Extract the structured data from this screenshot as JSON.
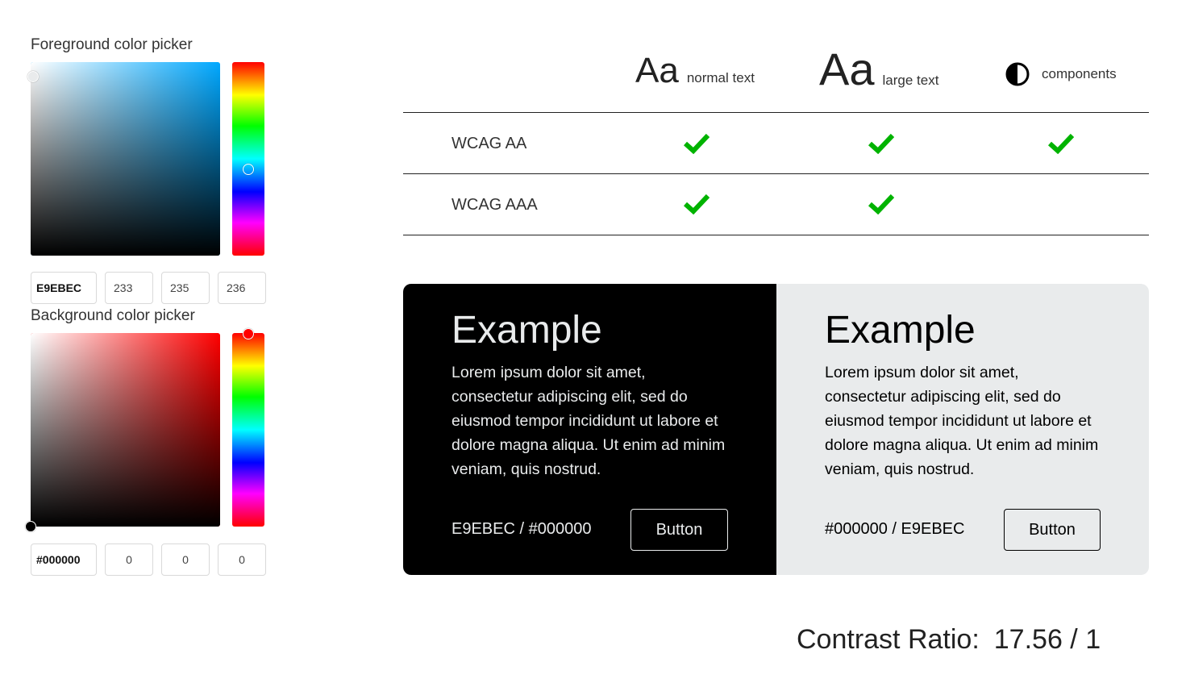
{
  "foreground": {
    "label": "Foreground color picker",
    "hue_color": "#00a8ff",
    "hex": "E9EBEC",
    "r": "233",
    "g": "235",
    "b": "236"
  },
  "background": {
    "label": "Background color picker",
    "hue_color": "#ff0000",
    "hex": "#000000",
    "r": "0",
    "g": "0",
    "b": "0"
  },
  "table": {
    "headers": [
      {
        "glyph": "Aa",
        "label": "normal text"
      },
      {
        "glyph": "Aa",
        "label": "large text"
      },
      {
        "icon": "contrast-icon",
        "label": "components"
      }
    ],
    "rows": [
      {
        "label": "WCAG AA",
        "normal": true,
        "large": true,
        "components": true
      },
      {
        "label": "WCAG AAA",
        "normal": true,
        "large": true,
        "components": false
      }
    ],
    "check_color": "#00b300"
  },
  "preview": {
    "dark": {
      "title": "Example",
      "body": "Lorem ipsum dolor sit amet, consectetur adipiscing elit, sed do eiusmod tempor incididunt ut labore et dolore magna aliqua. Ut enim ad minim veniam, quis nostrud.",
      "pair": "E9EBEC / #000000",
      "button": "Button",
      "bg": "#000000",
      "fg": "#E9EBEC"
    },
    "light": {
      "title": "Example",
      "body": "Lorem ipsum dolor sit amet, consectetur adipiscing elit, sed do eiusmod tempor incididunt ut labore et dolore magna aliqua. Ut enim ad minim veniam, quis nostrud.",
      "pair": "#000000 / E9EBEC",
      "button": "Button",
      "bg": "#E9EBEC",
      "fg": "#000000"
    }
  },
  "contrast": {
    "label": "Contrast Ratio:",
    "value": "17.56 / 1"
  }
}
